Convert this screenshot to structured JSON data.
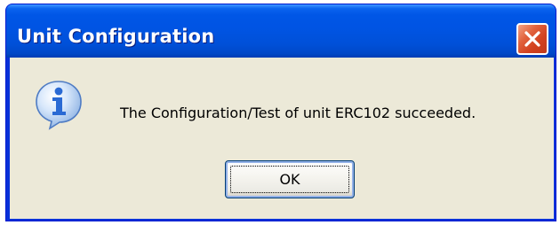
{
  "dialog": {
    "title": "Unit Configuration",
    "message": "The Configuration/Test of unit ERC102 succeeded.",
    "ok_label": "OK",
    "icon": "information-icon",
    "close_icon": "close-icon"
  },
  "colors": {
    "titlebar": "#0054e3",
    "client_background": "#ece9d8",
    "close_button": "#d34220",
    "info_icon_fill": "#2a6ad4",
    "button_border": "#003c74"
  }
}
